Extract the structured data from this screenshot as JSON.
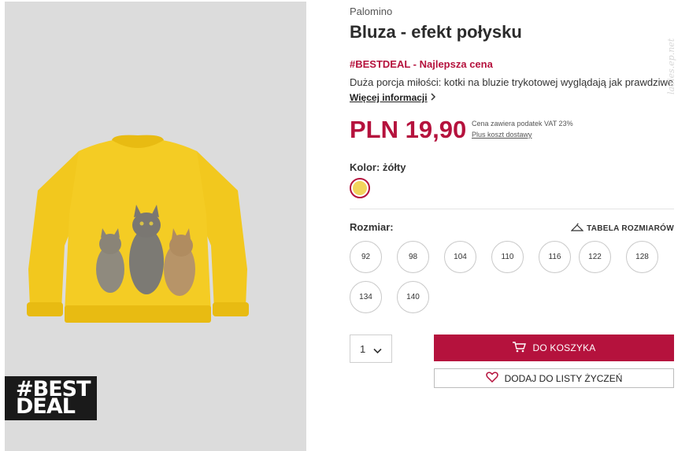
{
  "product": {
    "brand": "Palomino",
    "title": "Bluza - efekt połysku",
    "deal": "#BESTDEAL - Najlepsza cena",
    "description": "Duża porcja miłości: kotki na bluzie trykotowej wyglądają jak prawdziwe",
    "more_link": "Więcej informacji",
    "price": "PLN 19,90",
    "vat_note": "Cena zawiera podatek VAT 23%",
    "shipping_link": "Plus koszt dostawy"
  },
  "badge": {
    "line1": "#BEST",
    "line2": "DEAL"
  },
  "watermark": "ladies.ep.net",
  "color": {
    "label": "Kolor: żółty",
    "swatch_hex": "#f2d45c"
  },
  "size": {
    "label": "Rozmiar:",
    "table_link": "TABELA ROZMIARÓW",
    "options": [
      "92",
      "98",
      "104",
      "110",
      "116",
      "122",
      "128",
      "134",
      "140"
    ]
  },
  "quantity": {
    "value": "1"
  },
  "actions": {
    "add_to_cart": "DO KOSZYKA",
    "wishlist": "DODAJ DO LISTY ŻYCZEŃ"
  },
  "colors": {
    "accent": "#b5123d",
    "image_bg": "#dcdcdc",
    "sweater": "#f2c81e"
  },
  "icons": [
    "hanger-icon",
    "cart-icon",
    "heart-icon",
    "chevron-down-icon",
    "chevron-right-icon"
  ]
}
